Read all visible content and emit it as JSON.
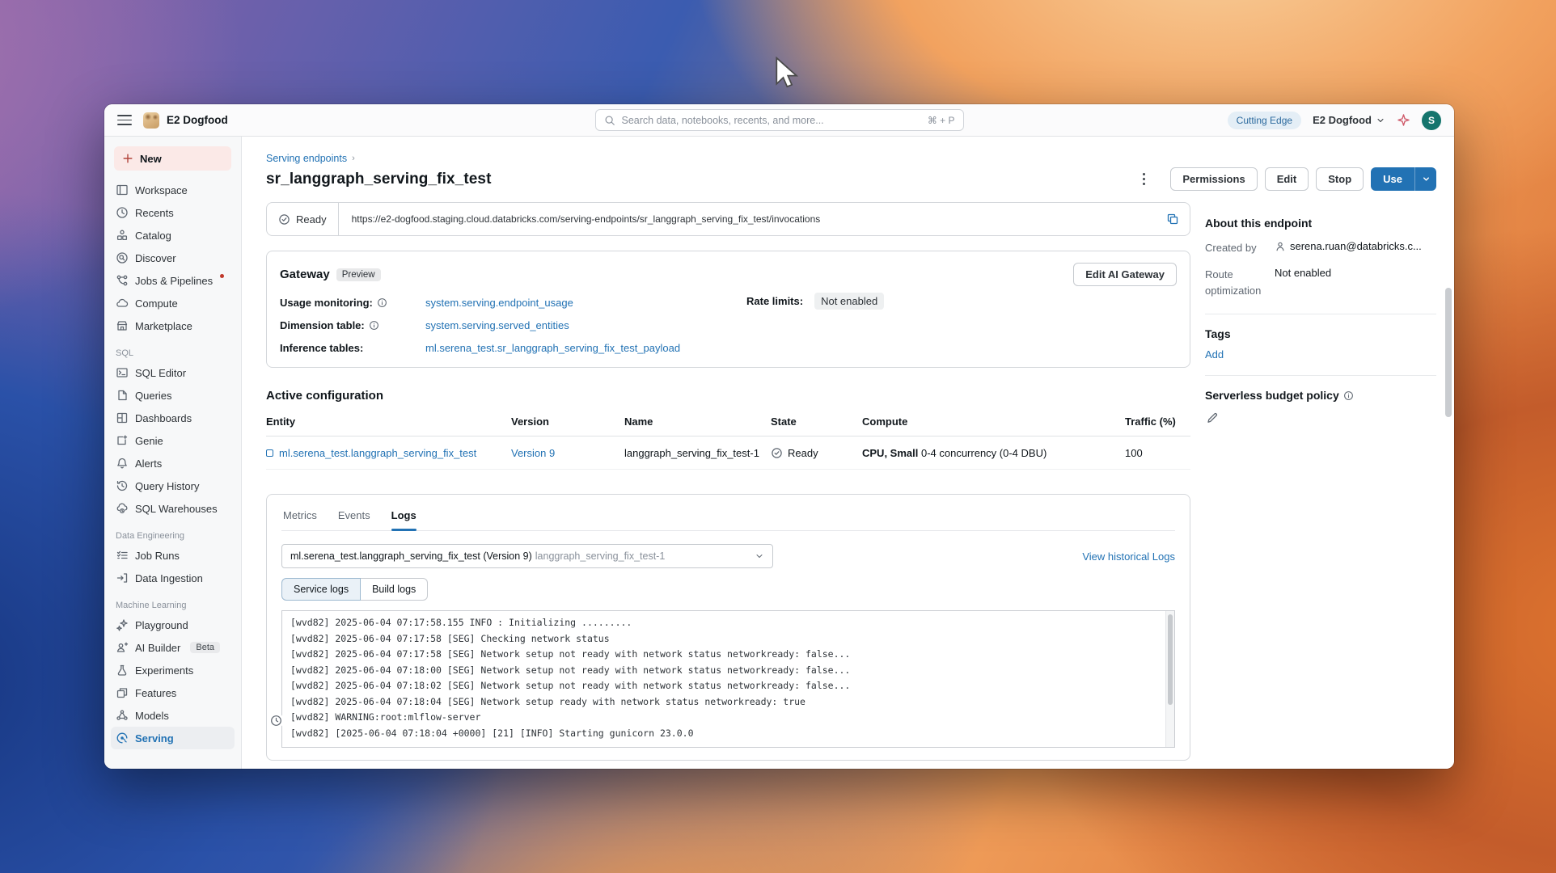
{
  "topbar": {
    "workspace_name": "E2 Dogfood",
    "search_placeholder": "Search data, notebooks, recents, and more...",
    "search_shortcut": "⌘ + P",
    "release_badge": "Cutting Edge",
    "org_name": "E2 Dogfood",
    "avatar_initial": "S"
  },
  "sidebar": {
    "new_label": "New",
    "items": [
      {
        "label": "Workspace"
      },
      {
        "label": "Recents"
      },
      {
        "label": "Catalog"
      },
      {
        "label": "Discover"
      },
      {
        "label": "Jobs & Pipelines"
      },
      {
        "label": "Compute"
      },
      {
        "label": "Marketplace"
      }
    ],
    "sections": [
      {
        "title": "SQL",
        "items": [
          "SQL Editor",
          "Queries",
          "Dashboards",
          "Genie",
          "Alerts",
          "Query History",
          "SQL Warehouses"
        ]
      },
      {
        "title": "Data Engineering",
        "items": [
          "Job Runs",
          "Data Ingestion"
        ]
      },
      {
        "title": "Machine Learning",
        "items": [
          "Playground",
          "AI Builder",
          "Experiments",
          "Features",
          "Models",
          "Serving"
        ]
      }
    ],
    "ai_builder_badge": "Beta"
  },
  "main": {
    "breadcrumb": "Serving endpoints",
    "title": "sr_langgraph_serving_fix_test",
    "actions": {
      "permissions": "Permissions",
      "edit": "Edit",
      "stop": "Stop",
      "use": "Use"
    },
    "status": {
      "label": "Ready",
      "url": "https://e2-dogfood.staging.cloud.databricks.com/serving-endpoints/sr_langgraph_serving_fix_test/invocations"
    },
    "gateway": {
      "title": "Gateway",
      "badge": "Preview",
      "edit_button": "Edit AI Gateway",
      "rows": [
        {
          "label": "Usage monitoring:",
          "value": "system.serving.endpoint_usage"
        },
        {
          "label": "Dimension table:",
          "value": "system.serving.served_entities"
        },
        {
          "label": "Inference tables:",
          "value": "ml.serena_test.sr_langgraph_serving_fix_test_payload"
        }
      ],
      "rate_limits_label": "Rate limits:",
      "rate_limits_value": "Not enabled"
    },
    "active_config": {
      "title": "Active configuration",
      "columns": [
        "Entity",
        "Version",
        "Name",
        "State",
        "Compute",
        "Traffic (%)"
      ],
      "row": {
        "entity": "ml.serena_test.langgraph_serving_fix_test",
        "version": "Version 9",
        "name": "langgraph_serving_fix_test-1",
        "state": "Ready",
        "compute_bold": "CPU, Small",
        "compute_rest": " 0-4 concurrency (0-4 DBU)",
        "traffic": "100"
      }
    },
    "tabs_panel": {
      "tabs": [
        "Metrics",
        "Events",
        "Logs"
      ],
      "active_tab": "Logs",
      "selector_main": "ml.serena_test.langgraph_serving_fix_test (Version 9)",
      "selector_secondary": "langgraph_serving_fix_test-1",
      "historical_link": "View historical Logs",
      "log_tabs": [
        "Service logs",
        "Build logs"
      ],
      "log_lines": [
        "[wvd82] 2025-06-04 07:17:58.155 INFO : Initializing .........",
        "[wvd82] 2025-06-04 07:17:58 [SEG] Checking network status",
        "[wvd82] 2025-06-04 07:17:58 [SEG] Network setup not ready with network status networkready: false...",
        "[wvd82] 2025-06-04 07:18:00 [SEG] Network setup not ready with network status networkready: false...",
        "[wvd82] 2025-06-04 07:18:02 [SEG] Network setup not ready with network status networkready: false...",
        "[wvd82] 2025-06-04 07:18:04 [SEG] Network setup ready with network status networkready: true",
        "[wvd82] WARNING:root:mlflow-server",
        "[wvd82] [2025-06-04 07:18:04 +0000] [21] [INFO] Starting gunicorn 23.0.0"
      ]
    }
  },
  "right_panel": {
    "title": "About this endpoint",
    "created_by_label": "Created by",
    "created_by_value": "serena.ruan@databricks.c...",
    "route_label": "Route optimization",
    "route_value": "Not enabled",
    "tags_title": "Tags",
    "tags_add": "Add",
    "budget_title": "Serverless budget policy"
  },
  "colors": {
    "accent": "#2272b4",
    "ready_icon": "#5f6771",
    "new_button_bg": "#fbe9e7"
  }
}
